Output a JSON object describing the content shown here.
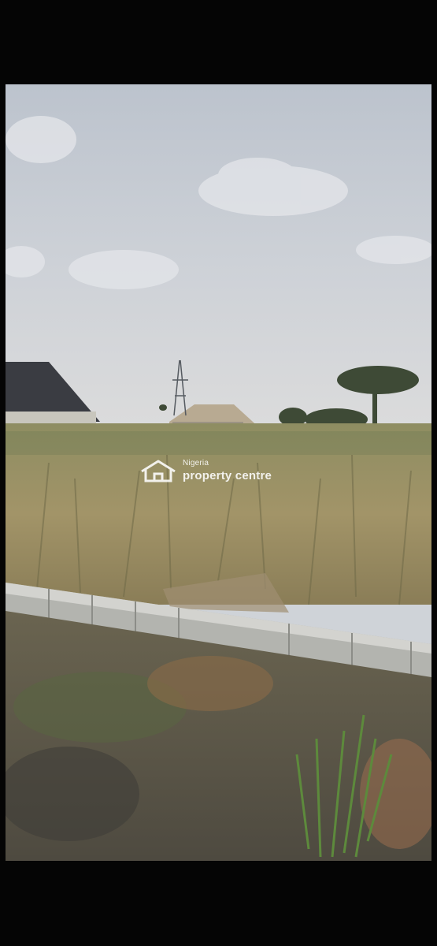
{
  "watermark": {
    "icon": "house-logo-icon",
    "country": "Nigeria",
    "name": "property centre",
    "color": "#ffffff"
  },
  "colors": {
    "letterbox": "#050505",
    "sky": "#c9ced6",
    "grass": "#9a8f5e",
    "curb": "#b9bab6",
    "soil": "#5a5346"
  }
}
